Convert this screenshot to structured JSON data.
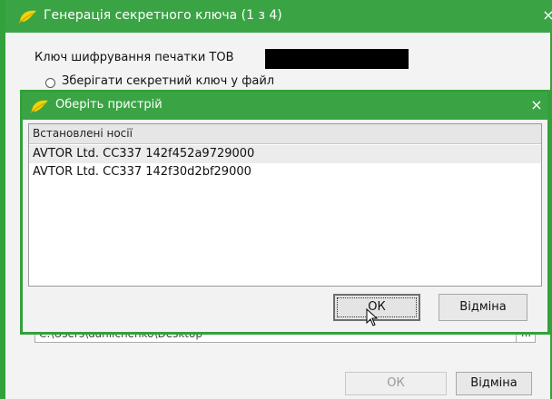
{
  "outer_window": {
    "title": "Генерація секретного ключа (1 з 4)",
    "label": "Ключ шифрування печатки ТОВ",
    "radio_label": "Зберігати секретний ключ у файл",
    "path_value": "C:\\Users\\danilchenko\\Desktop",
    "path_browse": "...",
    "ok_label": "ОК",
    "cancel_label": "Відміна",
    "close_glyph": "×"
  },
  "inner_dialog": {
    "title": "Оберіть пристрій",
    "close_glyph": "×",
    "list_header": "Встановлені носії",
    "items": [
      "AVTOR Ltd. CC337 142f452a9729000",
      "AVTOR Ltd. CC337 142f30d2bf29000"
    ],
    "ok_label": "ОК",
    "cancel_label": "Відміна"
  },
  "colors": {
    "title_bar": "#3aa444",
    "border": "#33a13b"
  },
  "icons": {
    "app_logo": "yellow-leaf-logo-icon",
    "close": "close-icon",
    "cursor": "mouse-pointer-icon"
  }
}
